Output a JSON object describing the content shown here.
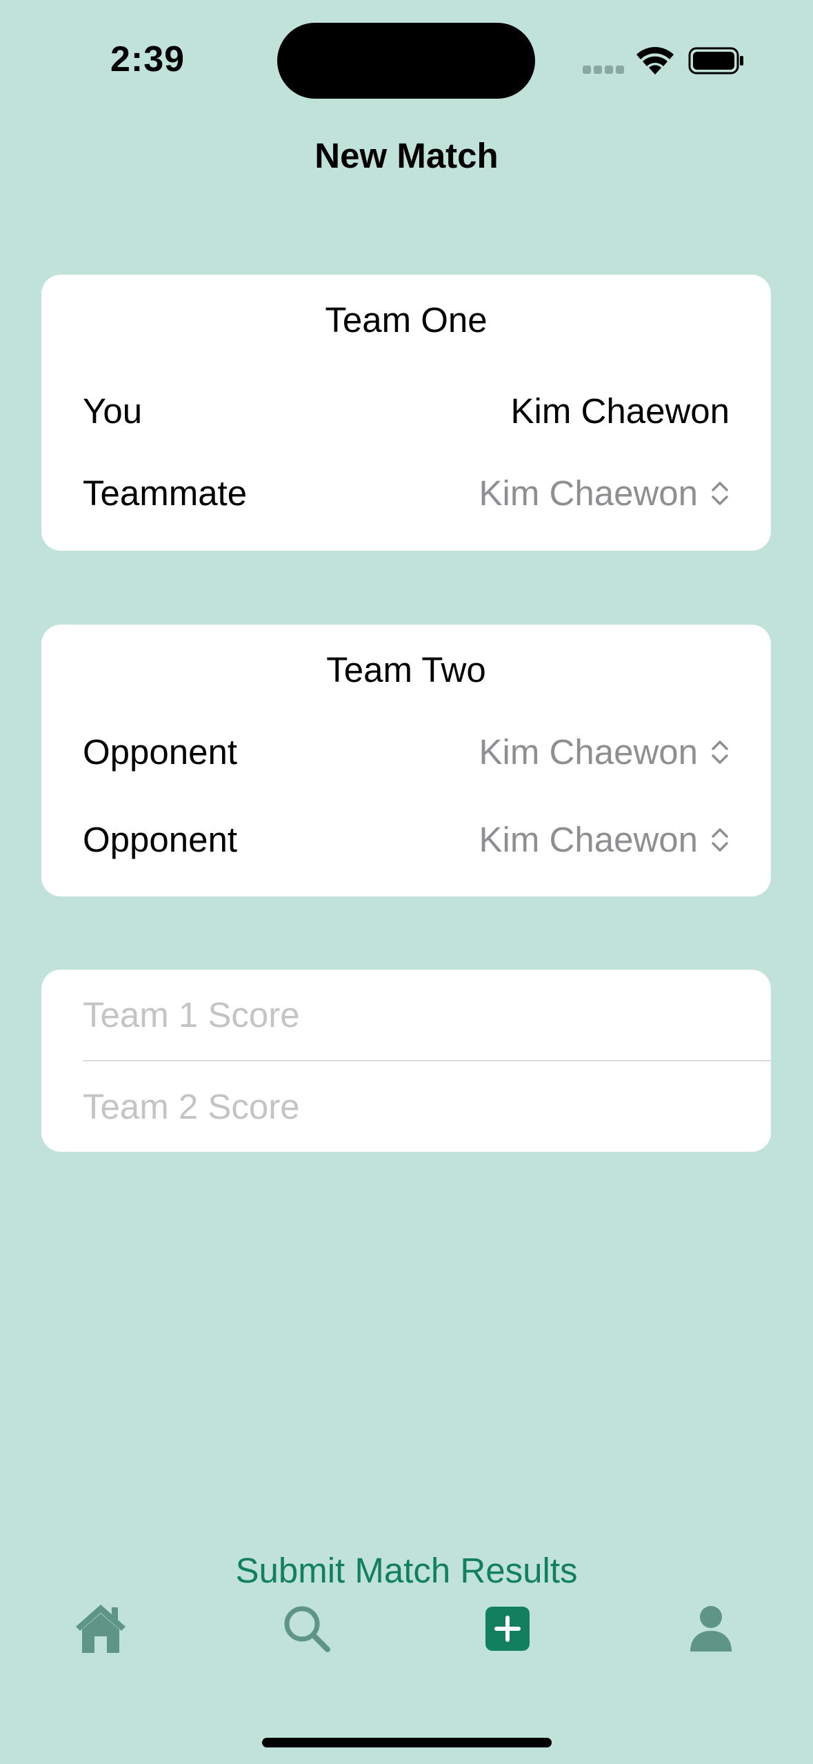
{
  "status_bar": {
    "time": "2:39"
  },
  "header": {
    "title": "New Match"
  },
  "team_one": {
    "title": "Team One",
    "rows": [
      {
        "label": "You",
        "value": "Kim Chaewon"
      },
      {
        "label": "Teammate",
        "value": "Kim Chaewon"
      }
    ]
  },
  "team_two": {
    "title": "Team Two",
    "rows": [
      {
        "label": "Opponent",
        "value": "Kim Chaewon"
      },
      {
        "label": "Opponent",
        "value": "Kim Chaewon"
      }
    ]
  },
  "scores": {
    "team1_placeholder": "Team 1 Score",
    "team2_placeholder": "Team 2 Score"
  },
  "actions": {
    "submit_label": "Submit Match Results"
  },
  "tab_bar": {
    "items": [
      {
        "icon": "house-icon",
        "active": false
      },
      {
        "icon": "search-icon",
        "active": false
      },
      {
        "icon": "plus-square-icon",
        "active": true
      },
      {
        "icon": "person-icon",
        "active": false
      }
    ]
  },
  "colors": {
    "background": "#c0e2d9",
    "accent": "#12805c",
    "tab_icon_inactive": "#5f9585",
    "placeholder": "#c4c4c6",
    "picker_value": "#8e8e93"
  }
}
